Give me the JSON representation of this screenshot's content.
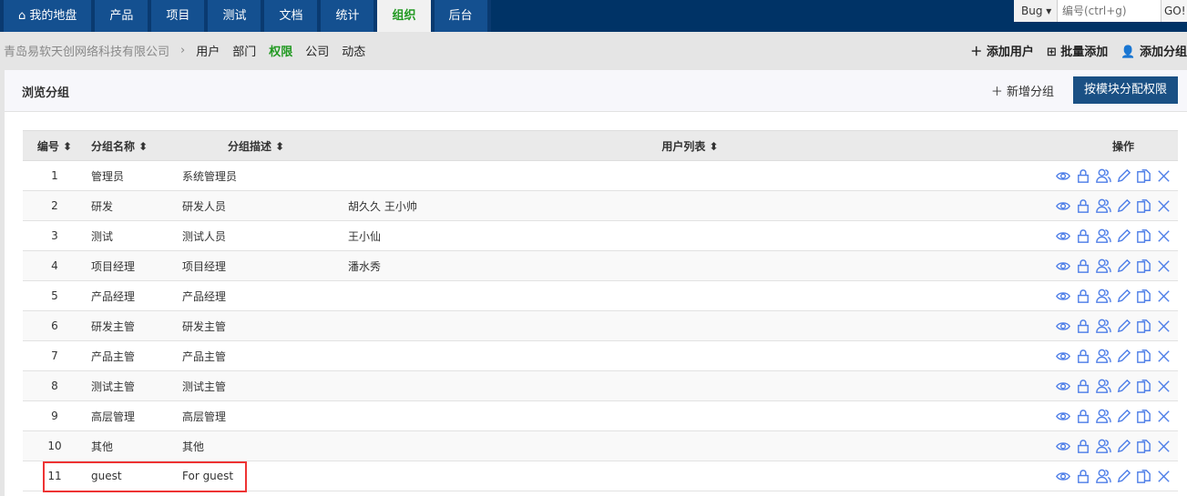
{
  "nav": [
    "我的地盘",
    "产品",
    "项目",
    "测试",
    "文档",
    "统计",
    "组织",
    "后台"
  ],
  "nav_active": 6,
  "search": {
    "type": "Bug",
    "placeholder": "编号(ctrl+g)",
    "go": "GO!"
  },
  "breadcrumb": {
    "company": "青岛易软天创网络科技有限公司",
    "sep": "›",
    "subnav": [
      "用户",
      "部门",
      "权限",
      "公司",
      "动态"
    ],
    "active": 2
  },
  "actions": [
    "添加用户",
    "批量添加",
    "添加分组"
  ],
  "panel": {
    "title": "浏览分组",
    "new_group": "新增分组",
    "assign_btn": "按模块分配权限"
  },
  "table": {
    "headers": [
      "编号 ⬍",
      "分组名称 ⬍",
      "分组描述 ⬍",
      "用户列表 ⬍",
      "操作"
    ],
    "rows": [
      [
        "1",
        "管理员",
        "系统管理员",
        ""
      ],
      [
        "2",
        "研发",
        "研发人员",
        "胡久久 王小帅"
      ],
      [
        "3",
        "测试",
        "测试人员",
        "王小仙"
      ],
      [
        "4",
        "项目经理",
        "项目经理",
        "潘水秀"
      ],
      [
        "5",
        "产品经理",
        "产品经理",
        ""
      ],
      [
        "6",
        "研发主管",
        "研发主管",
        ""
      ],
      [
        "7",
        "产品主管",
        "产品主管",
        ""
      ],
      [
        "8",
        "测试主管",
        "测试主管",
        ""
      ],
      [
        "9",
        "高层管理",
        "高层管理",
        ""
      ],
      [
        "10",
        "其他",
        "其他",
        ""
      ],
      [
        "11",
        "guest",
        "For guest",
        ""
      ]
    ]
  }
}
